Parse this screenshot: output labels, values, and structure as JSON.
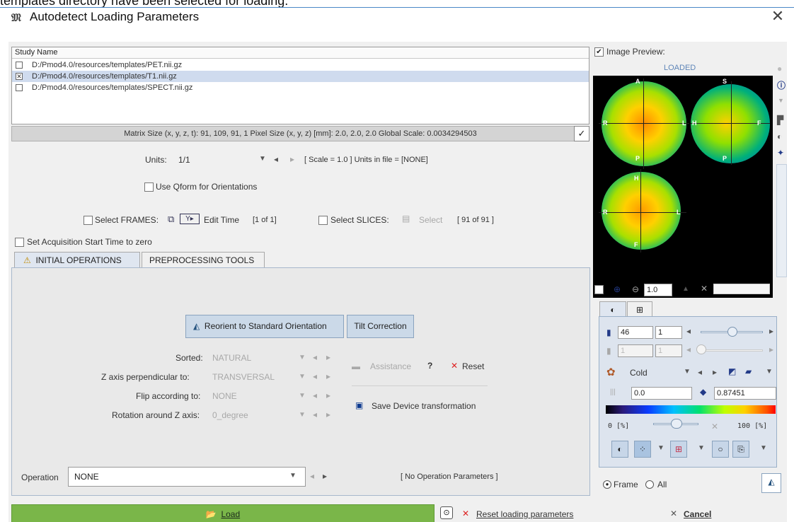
{
  "caption": "templates directory have been selected for loading.",
  "window": {
    "title": "Autodetect Loading Parameters",
    "close_symbol": "✕"
  },
  "study_list": {
    "header": "Study Name",
    "rows": [
      {
        "path": "D:/Pmod4.0/resources/templates/PET.nii.gz",
        "checked": false
      },
      {
        "path": "D:/Pmod4.0/resources/templates/T1.nii.gz",
        "checked": true
      },
      {
        "path": "D:/Pmod4.0/resources/templates/SPECT.nii.gz",
        "checked": false
      }
    ]
  },
  "matrix_info": "Matrix Size (x, y, z, t): 91, 109, 91, 1   Pixel Size (x, y, z) [mm]: 2.0, 2.0, 2.0   Global Scale: 0.0034294503",
  "units": {
    "label": "Units:",
    "value": "1/1",
    "scale_text": "[ Scale = 1.0 ]  Units in file = [NONE]"
  },
  "qform_label": "Use Qform for Orientations",
  "frames": {
    "select_label": "Select FRAMES:",
    "edit_time_label": "Edit Time",
    "count": "[1 of 1]"
  },
  "slices": {
    "select_label": "Select SLICES:",
    "select_button": "Select",
    "count": "[ 91 of 91 ]"
  },
  "acq_label": "Set Acquisition Start Time to zero",
  "tabs": [
    "INITIAL OPERATIONS",
    "PREPROCESSING TOOLS"
  ],
  "ops": {
    "reorient_button": "Reorient to Standard Orientation",
    "tilt_button": "Tilt Correction",
    "sorted_label": "Sorted:",
    "sorted_value": "NATURAL",
    "zaxis_label": "Z axis perpendicular to:",
    "zaxis_value": "TRANSVERSAL",
    "flip_label": "Flip according to:",
    "flip_value": "NONE",
    "rotation_label": "Rotation around Z axis:",
    "rotation_value": "0_degree",
    "assistance": "Assistance",
    "help": "?",
    "reset": "Reset",
    "save_device": "Save Device transformation",
    "operation_label": "Operation",
    "operation_value": "NONE",
    "no_params": "[ No Operation Parameters ]"
  },
  "preview": {
    "checkbox_label": "Image Preview:",
    "status": "LOADED",
    "zoom_value": "1.0"
  },
  "color_panel": {
    "slice_value": "46",
    "step_value": "1",
    "frame_value": "1",
    "frame_step": "1",
    "lut_name": "Cold",
    "min_value": "0.0",
    "max_value": "0.87451",
    "range_min": "0  [%]",
    "range_max": "100  [%]",
    "slider_level_percent": 60,
    "frame_radio": "Frame",
    "all_radio": "All"
  },
  "bottom": {
    "load": "Load",
    "reset_params": "Reset loading parameters",
    "cancel": "Cancel"
  },
  "colors": {
    "load_green": "#7ab649",
    "selection": "#cfdbee",
    "accent": "#4a88c7"
  }
}
